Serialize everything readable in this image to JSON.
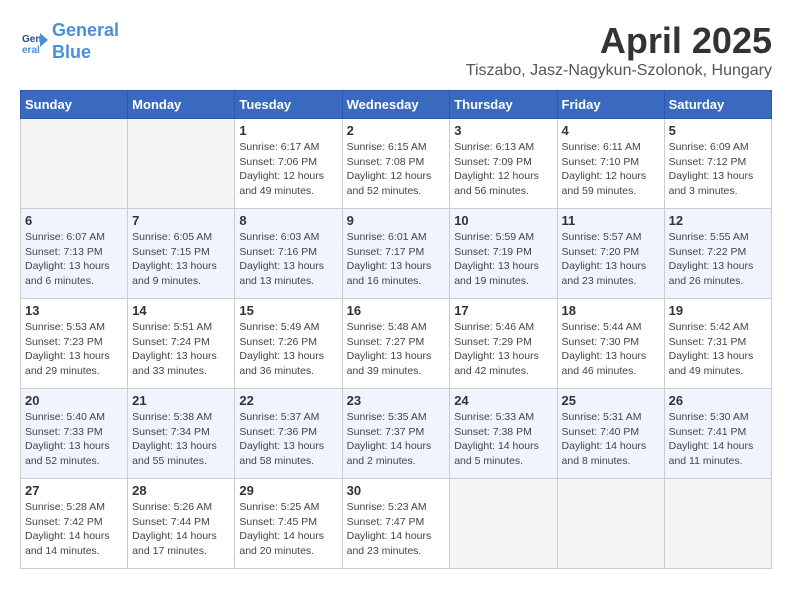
{
  "logo": {
    "line1": "General",
    "line2": "Blue"
  },
  "title": "April 2025",
  "location": "Tiszabo, Jasz-Nagykun-Szolonok, Hungary",
  "days_of_week": [
    "Sunday",
    "Monday",
    "Tuesday",
    "Wednesday",
    "Thursday",
    "Friday",
    "Saturday"
  ],
  "weeks": [
    [
      {
        "day": "",
        "detail": ""
      },
      {
        "day": "",
        "detail": ""
      },
      {
        "day": "1",
        "detail": "Sunrise: 6:17 AM\nSunset: 7:06 PM\nDaylight: 12 hours\nand 49 minutes."
      },
      {
        "day": "2",
        "detail": "Sunrise: 6:15 AM\nSunset: 7:08 PM\nDaylight: 12 hours\nand 52 minutes."
      },
      {
        "day": "3",
        "detail": "Sunrise: 6:13 AM\nSunset: 7:09 PM\nDaylight: 12 hours\nand 56 minutes."
      },
      {
        "day": "4",
        "detail": "Sunrise: 6:11 AM\nSunset: 7:10 PM\nDaylight: 12 hours\nand 59 minutes."
      },
      {
        "day": "5",
        "detail": "Sunrise: 6:09 AM\nSunset: 7:12 PM\nDaylight: 13 hours\nand 3 minutes."
      }
    ],
    [
      {
        "day": "6",
        "detail": "Sunrise: 6:07 AM\nSunset: 7:13 PM\nDaylight: 13 hours\nand 6 minutes."
      },
      {
        "day": "7",
        "detail": "Sunrise: 6:05 AM\nSunset: 7:15 PM\nDaylight: 13 hours\nand 9 minutes."
      },
      {
        "day": "8",
        "detail": "Sunrise: 6:03 AM\nSunset: 7:16 PM\nDaylight: 13 hours\nand 13 minutes."
      },
      {
        "day": "9",
        "detail": "Sunrise: 6:01 AM\nSunset: 7:17 PM\nDaylight: 13 hours\nand 16 minutes."
      },
      {
        "day": "10",
        "detail": "Sunrise: 5:59 AM\nSunset: 7:19 PM\nDaylight: 13 hours\nand 19 minutes."
      },
      {
        "day": "11",
        "detail": "Sunrise: 5:57 AM\nSunset: 7:20 PM\nDaylight: 13 hours\nand 23 minutes."
      },
      {
        "day": "12",
        "detail": "Sunrise: 5:55 AM\nSunset: 7:22 PM\nDaylight: 13 hours\nand 26 minutes."
      }
    ],
    [
      {
        "day": "13",
        "detail": "Sunrise: 5:53 AM\nSunset: 7:23 PM\nDaylight: 13 hours\nand 29 minutes."
      },
      {
        "day": "14",
        "detail": "Sunrise: 5:51 AM\nSunset: 7:24 PM\nDaylight: 13 hours\nand 33 minutes."
      },
      {
        "day": "15",
        "detail": "Sunrise: 5:49 AM\nSunset: 7:26 PM\nDaylight: 13 hours\nand 36 minutes."
      },
      {
        "day": "16",
        "detail": "Sunrise: 5:48 AM\nSunset: 7:27 PM\nDaylight: 13 hours\nand 39 minutes."
      },
      {
        "day": "17",
        "detail": "Sunrise: 5:46 AM\nSunset: 7:29 PM\nDaylight: 13 hours\nand 42 minutes."
      },
      {
        "day": "18",
        "detail": "Sunrise: 5:44 AM\nSunset: 7:30 PM\nDaylight: 13 hours\nand 46 minutes."
      },
      {
        "day": "19",
        "detail": "Sunrise: 5:42 AM\nSunset: 7:31 PM\nDaylight: 13 hours\nand 49 minutes."
      }
    ],
    [
      {
        "day": "20",
        "detail": "Sunrise: 5:40 AM\nSunset: 7:33 PM\nDaylight: 13 hours\nand 52 minutes."
      },
      {
        "day": "21",
        "detail": "Sunrise: 5:38 AM\nSunset: 7:34 PM\nDaylight: 13 hours\nand 55 minutes."
      },
      {
        "day": "22",
        "detail": "Sunrise: 5:37 AM\nSunset: 7:36 PM\nDaylight: 13 hours\nand 58 minutes."
      },
      {
        "day": "23",
        "detail": "Sunrise: 5:35 AM\nSunset: 7:37 PM\nDaylight: 14 hours\nand 2 minutes."
      },
      {
        "day": "24",
        "detail": "Sunrise: 5:33 AM\nSunset: 7:38 PM\nDaylight: 14 hours\nand 5 minutes."
      },
      {
        "day": "25",
        "detail": "Sunrise: 5:31 AM\nSunset: 7:40 PM\nDaylight: 14 hours\nand 8 minutes."
      },
      {
        "day": "26",
        "detail": "Sunrise: 5:30 AM\nSunset: 7:41 PM\nDaylight: 14 hours\nand 11 minutes."
      }
    ],
    [
      {
        "day": "27",
        "detail": "Sunrise: 5:28 AM\nSunset: 7:42 PM\nDaylight: 14 hours\nand 14 minutes."
      },
      {
        "day": "28",
        "detail": "Sunrise: 5:26 AM\nSunset: 7:44 PM\nDaylight: 14 hours\nand 17 minutes."
      },
      {
        "day": "29",
        "detail": "Sunrise: 5:25 AM\nSunset: 7:45 PM\nDaylight: 14 hours\nand 20 minutes."
      },
      {
        "day": "30",
        "detail": "Sunrise: 5:23 AM\nSunset: 7:47 PM\nDaylight: 14 hours\nand 23 minutes."
      },
      {
        "day": "",
        "detail": ""
      },
      {
        "day": "",
        "detail": ""
      },
      {
        "day": "",
        "detail": ""
      }
    ]
  ]
}
